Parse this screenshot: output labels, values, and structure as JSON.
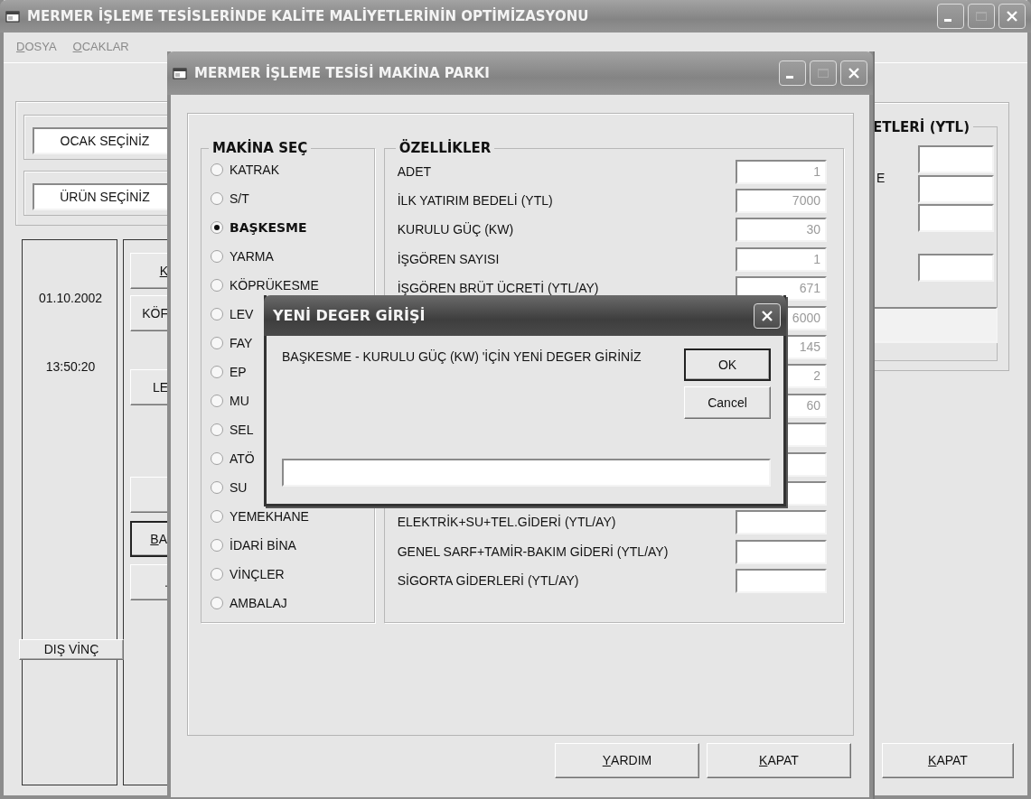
{
  "main_window": {
    "title": "MERMER İŞLEME TESİSLERİNDE KALİTE MALİYETLERİNİN OPTİMİZASYONU",
    "menu": [
      {
        "label": "DOSYA",
        "mnemonic": true
      },
      {
        "label": "OCAKLAR",
        "mnemonic": true
      }
    ],
    "selectors": [
      {
        "text": "OCAK SEÇİNİZ"
      },
      {
        "text": "ÜRÜN SEÇİNİZ"
      }
    ],
    "date": "01.10.2002",
    "time": "13:50:20",
    "side_buttons": [
      {
        "label": "K",
        "mnemonic": true,
        "default": false
      },
      {
        "label": "KÖF",
        "default": false
      },
      {
        "label": "LE",
        "default": false
      },
      {
        "default": false
      },
      {
        "label": "BA",
        "mnemonic": true,
        "default": true
      },
      {
        "label": ".",
        "default": false
      }
    ],
    "crane_button": {
      "label": "DIŞ VİNÇ"
    },
    "cost_group": {
      "title": "ETLERİ (YTL)",
      "label": "E"
    },
    "close_button": {
      "label": "KAPAT",
      "mnemonic": true
    }
  },
  "machine_window": {
    "title": "MERMER İŞLEME TESİSİ MAKİNA PARKI",
    "machine_group": {
      "title": "MAKİNA SEÇ",
      "options": [
        {
          "label": "KATRAK",
          "selected": false
        },
        {
          "label": "S/T",
          "selected": false
        },
        {
          "label": "BAŞKESME",
          "selected": true
        },
        {
          "label": "YARMA",
          "selected": false
        },
        {
          "label": "KÖPRÜKESME",
          "selected": false
        },
        {
          "label": "LEV",
          "selected": false
        },
        {
          "label": "FAY",
          "selected": false
        },
        {
          "label": "EP",
          "selected": false
        },
        {
          "label": "MU",
          "selected": false
        },
        {
          "label": "SEL",
          "selected": false
        },
        {
          "label": "ATÖ",
          "selected": false
        },
        {
          "label": "SU",
          "selected": false
        },
        {
          "label": "YEMEKHANE",
          "selected": false
        },
        {
          "label": "İDARİ BİNA",
          "selected": false
        },
        {
          "label": "VİNÇLER",
          "selected": false
        },
        {
          "label": "AMBALAJ",
          "selected": false
        }
      ]
    },
    "properties": {
      "title": "ÖZELLİKLER",
      "rows": [
        {
          "label": "ADET",
          "value": "1"
        },
        {
          "label": "İLK YATIRIM BEDELİ (YTL)",
          "value": "7000"
        },
        {
          "label": "KURULU GÜÇ (KW)",
          "value": "30"
        },
        {
          "label": "İŞGÖREN SAYISI",
          "value": "1"
        },
        {
          "label": "İŞGÖREN BRÜT ÜCRETİ (YTL/AY)",
          "value": "671"
        },
        {
          "value": "6000"
        },
        {
          "value": "145"
        },
        {
          "value": "2"
        },
        {
          "value": "60"
        },
        {},
        {},
        {},
        {
          "label": "ELEKTRİK+SU+TEL.GİDERİ (YTL/AY)"
        },
        {
          "label": "GENEL SARF+TAMİR-BAKIM GİDERİ (YTL/AY)"
        },
        {
          "label": "SİGORTA GİDERLERİ (YTL/AY)"
        }
      ]
    },
    "buttons": [
      {
        "label": "YARDIM",
        "mnemonic": true
      },
      {
        "label": "KAPAT",
        "mnemonic": true
      }
    ]
  },
  "input_dialog": {
    "title": "YENİ DEGER GİRİŞİ",
    "prompt": "BAŞKESME - KURULU GÜÇ (KW) 'İÇİN YENİ DEGER GİRİNİZ",
    "buttons": [
      {
        "label": "OK",
        "default": true
      },
      {
        "label": "Cancel",
        "default": false
      }
    ]
  }
}
